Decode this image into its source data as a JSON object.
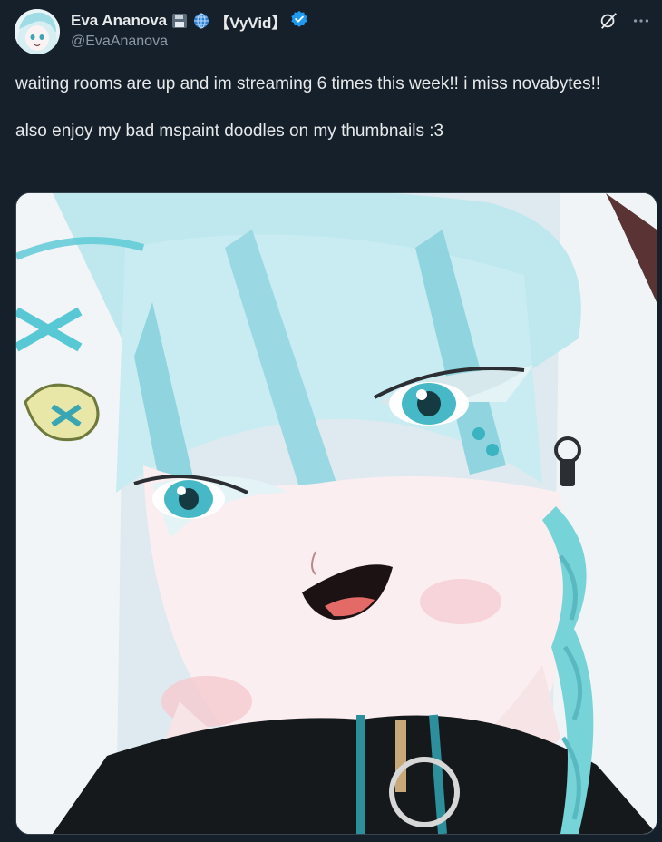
{
  "author": {
    "display_name": "Eva Ananova",
    "name_suffix": "【VyVid】",
    "handle": "@EvaAnanova",
    "emoji": [
      "floppy-disk",
      "globe"
    ],
    "verified_color": "#1d9bf0"
  },
  "post": {
    "text": "waiting rooms are up and im streaming 6 times this week!! i miss novabytes!!\n\nalso enjoy my bad mspaint doodles on my thumbnails :3"
  },
  "icons": {
    "grok": "grok-icon",
    "more": "more-icon"
  },
  "colors": {
    "background": "#15202b",
    "text": "#e7e9ea",
    "secondary_text": "#8b98a5",
    "accent": "#1d9bf0"
  }
}
